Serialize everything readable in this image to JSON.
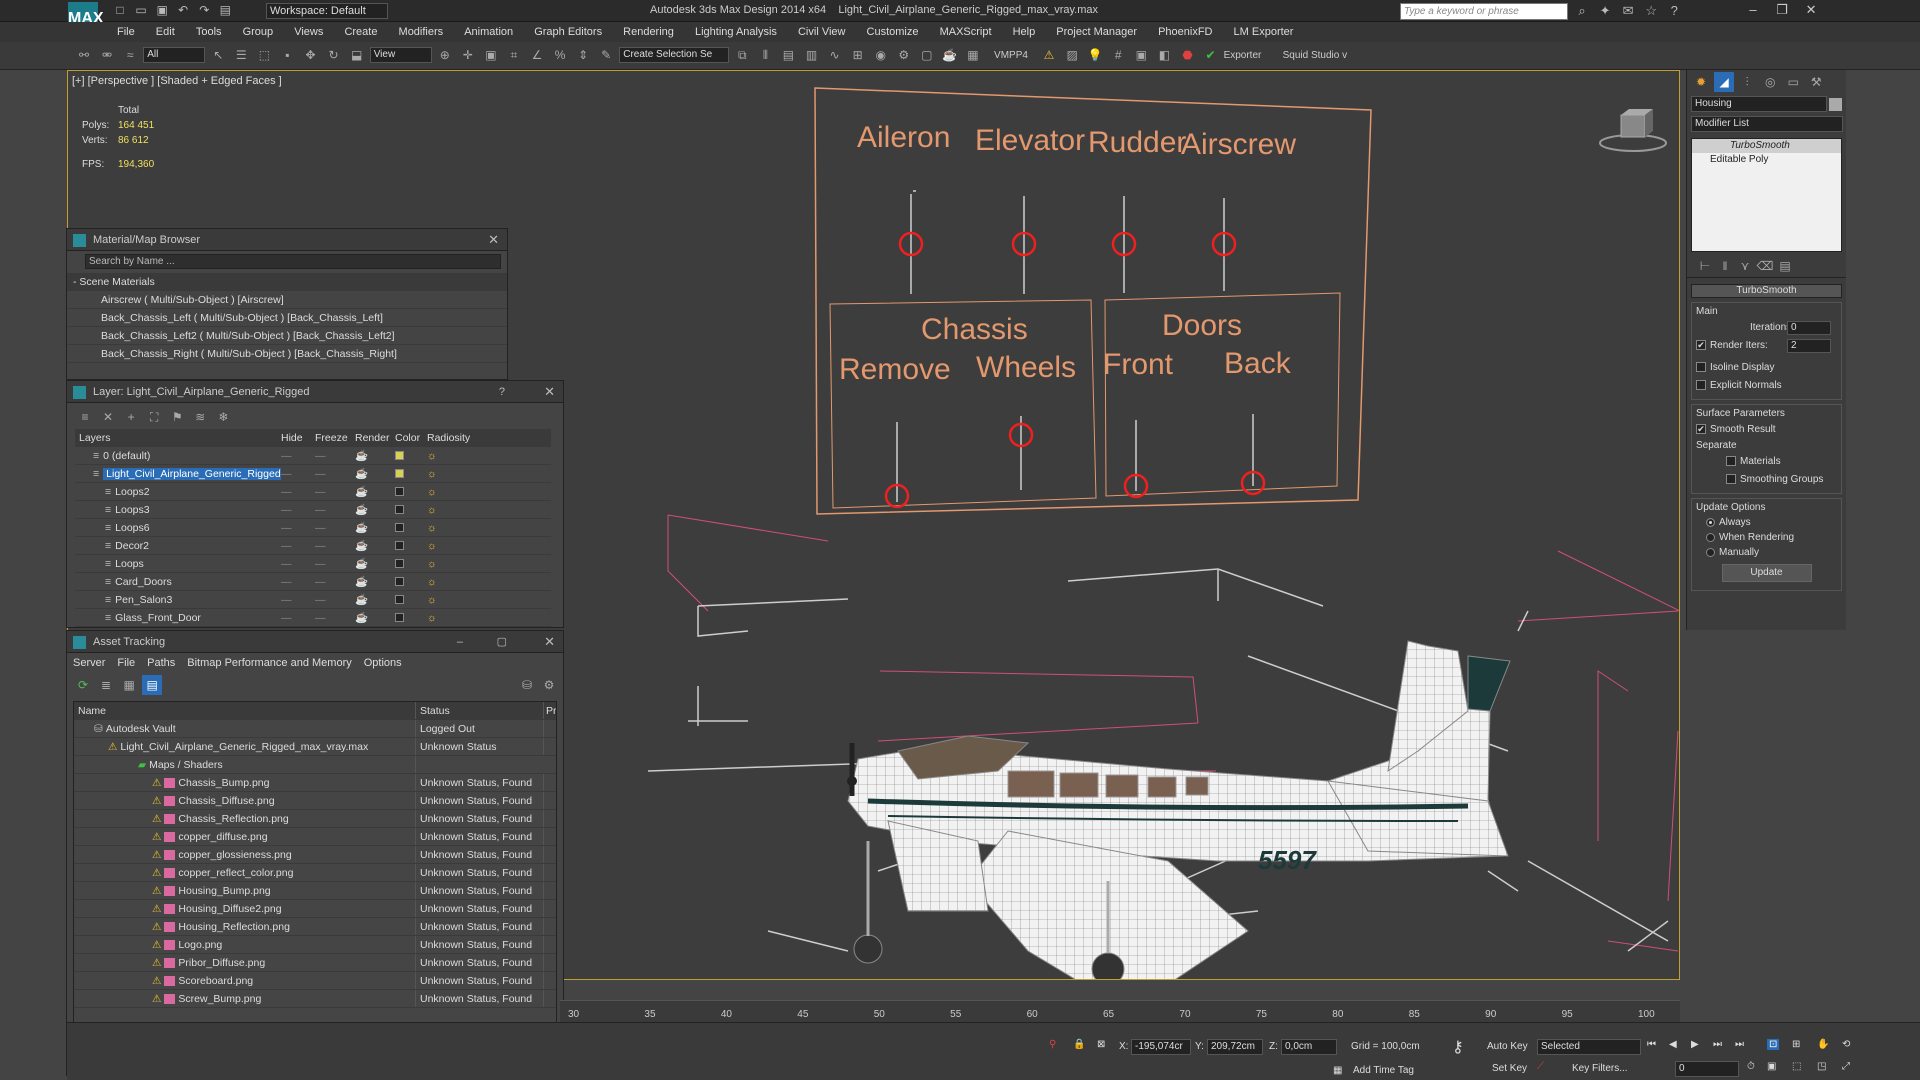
{
  "app": {
    "title": "Autodesk 3ds Max Design 2014 x64",
    "file": "Light_Civil_Airplane_Generic_Rigged_max_vray.max",
    "logo": "MAX",
    "workspace": "Workspace: Default",
    "search_placeholder": "Type a keyword or phrase"
  },
  "menu": [
    "File",
    "Edit",
    "Tools",
    "Group",
    "Views",
    "Create",
    "Modifiers",
    "Animation",
    "Graph Editors",
    "Rendering",
    "Lighting Analysis",
    "Civil View",
    "Customize",
    "MAXScript",
    "Help",
    "Project Manager",
    "PhoenixFD",
    "LM Exporter"
  ],
  "toolbar": {
    "filter": "All",
    "coord": "View",
    "selset": "Create Selection Se",
    "vmpp": "VMPP4",
    "exporter": "Exporter",
    "squid": "Squid Studio v"
  },
  "viewport": {
    "label": "[+] [Perspective ] [Shaded + Edged Faces ]",
    "stats_header": "Total",
    "polys_label": "Polys:",
    "polys": "164 451",
    "verts_label": "Verts:",
    "verts": "86 612",
    "fps_label": "FPS:",
    "fps": "194,360",
    "aircraft_number": "5597",
    "rig": {
      "top": [
        "Aileron",
        "Elevator",
        "Rudder",
        "Airscrew"
      ],
      "chassis_title": "Chassis",
      "chassis": [
        "Remove",
        "Wheels"
      ],
      "doors_title": "Doors",
      "doors": [
        "Front",
        "Back"
      ],
      "accent": "#e3986e"
    }
  },
  "material_browser": {
    "title": "Material/Map Browser",
    "search": "Search by Name ...",
    "section": "- Scene Materials",
    "items": [
      "Airscrew ( Multi/Sub-Object ) [Airscrew]",
      "Back_Chassis_Left ( Multi/Sub-Object ) [Back_Chassis_Left]",
      "Back_Chassis_Left2 ( Multi/Sub-Object ) [Back_Chassis_Left2]",
      "Back_Chassis_Right ( Multi/Sub-Object ) [Back_Chassis_Right]"
    ]
  },
  "layer_window": {
    "title": "Layer: Light_Civil_Airplane_Generic_Rigged",
    "help": "?",
    "columns": [
      "Layers",
      "Hide",
      "Freeze",
      "Render",
      "Color",
      "Radiosity"
    ],
    "rows": [
      "0 (default)",
      "Light_Civil_Airplane_Generic_Rigged",
      "Loops2",
      "Loops3",
      "Loops6",
      "Decor2",
      "Loops",
      "Card_Doors",
      "Pen_Salon3",
      "Glass_Front_Door"
    ]
  },
  "asset_tracking": {
    "title": "Asset Tracking",
    "menu": [
      "Server",
      "File",
      "Paths",
      "Bitmap Performance and Memory",
      "Options"
    ],
    "columns": [
      "Name",
      "Status",
      "Pr"
    ],
    "rows": [
      {
        "name": "Autodesk Vault",
        "status": "Logged Out"
      },
      {
        "name": "Light_Civil_Airplane_Generic_Rigged_max_vray.max",
        "status": "Unknown Status"
      },
      {
        "name": "Maps / Shaders",
        "status": ""
      },
      {
        "name": "Chassis_Bump.png",
        "status": "Unknown Status, Found"
      },
      {
        "name": "Chassis_Diffuse.png",
        "status": "Unknown Status, Found"
      },
      {
        "name": "Chassis_Reflection.png",
        "status": "Unknown Status, Found"
      },
      {
        "name": "copper_diffuse.png",
        "status": "Unknown Status, Found"
      },
      {
        "name": "copper_glossieness.png",
        "status": "Unknown Status, Found"
      },
      {
        "name": "copper_reflect_color.png",
        "status": "Unknown Status, Found"
      },
      {
        "name": "Housing_Bump.png",
        "status": "Unknown Status, Found"
      },
      {
        "name": "Housing_Diffuse2.png",
        "status": "Unknown Status, Found"
      },
      {
        "name": "Housing_Reflection.png",
        "status": "Unknown Status, Found"
      },
      {
        "name": "Logo.png",
        "status": "Unknown Status, Found"
      },
      {
        "name": "Pribor_Diffuse.png",
        "status": "Unknown Status, Found"
      },
      {
        "name": "Scoreboard.png",
        "status": "Unknown Status, Found"
      },
      {
        "name": "Screw_Bump.png",
        "status": "Unknown Status, Found"
      }
    ]
  },
  "command_panel": {
    "object": "Housing",
    "modifier_list": "Modifier List",
    "stack": [
      "TurboSmooth",
      "Editable Poly"
    ],
    "rollout": "TurboSmooth",
    "main": "Main",
    "iterations_label": "Iterations:",
    "iterations": "0",
    "render_iters_label": "Render Iters:",
    "render_iters": "2",
    "isoline": "Isoline Display",
    "explicit": "Explicit Normals",
    "surface": "Surface Parameters",
    "smooth": "Smooth Result",
    "separate": "Separate",
    "materials": "Materials",
    "smoothing_groups": "Smoothing Groups",
    "update_options": "Update Options",
    "always": "Always",
    "when_rendering": "When Rendering",
    "manually": "Manually",
    "update": "Update"
  },
  "timeline": {
    "ticks": [
      "30",
      "35",
      "40",
      "45",
      "50",
      "55",
      "60",
      "65",
      "70",
      "75",
      "80",
      "85",
      "90",
      "95",
      "100"
    ]
  },
  "status": {
    "x_label": "X:",
    "x": "-195,074cr",
    "y_label": "Y:",
    "y": "209,72cm",
    "z_label": "Z:",
    "z": "0,0cm",
    "grid": "Grid = 100,0cm",
    "autokey": "Auto Key",
    "selected": "Selected",
    "setkey": "Set Key",
    "keyfilters": "Key Filters...",
    "addtimetag": "Add Time Tag",
    "frame": "0"
  }
}
